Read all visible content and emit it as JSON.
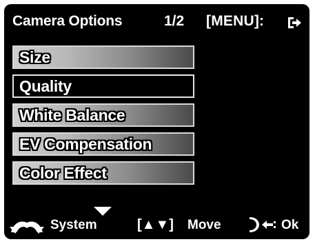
{
  "header": {
    "title": "Camera Options",
    "page": "1/2",
    "menu_hint": "[MENU]:",
    "exit_icon": "exit-arrow-icon"
  },
  "menu": {
    "items": [
      {
        "label": "Size",
        "selected": false
      },
      {
        "label": "Quality",
        "selected": true
      },
      {
        "label": "White Balance",
        "selected": false
      },
      {
        "label": "EV Compensation",
        "selected": false
      },
      {
        "label": "Color Effect",
        "selected": false
      }
    ]
  },
  "footer": {
    "system_label": "System",
    "nav_keys": "[▲▼]",
    "move_label": "Move",
    "ok_label": "Ok",
    "icons": [
      "down-triangle-icon",
      "system-arrows-icon",
      "ok-button-icon"
    ]
  },
  "colors": {
    "background": "#000000",
    "text": "#ffffff",
    "item_gradient_start": "#cfcfcf",
    "item_gradient_end": "#4a4a4a"
  }
}
